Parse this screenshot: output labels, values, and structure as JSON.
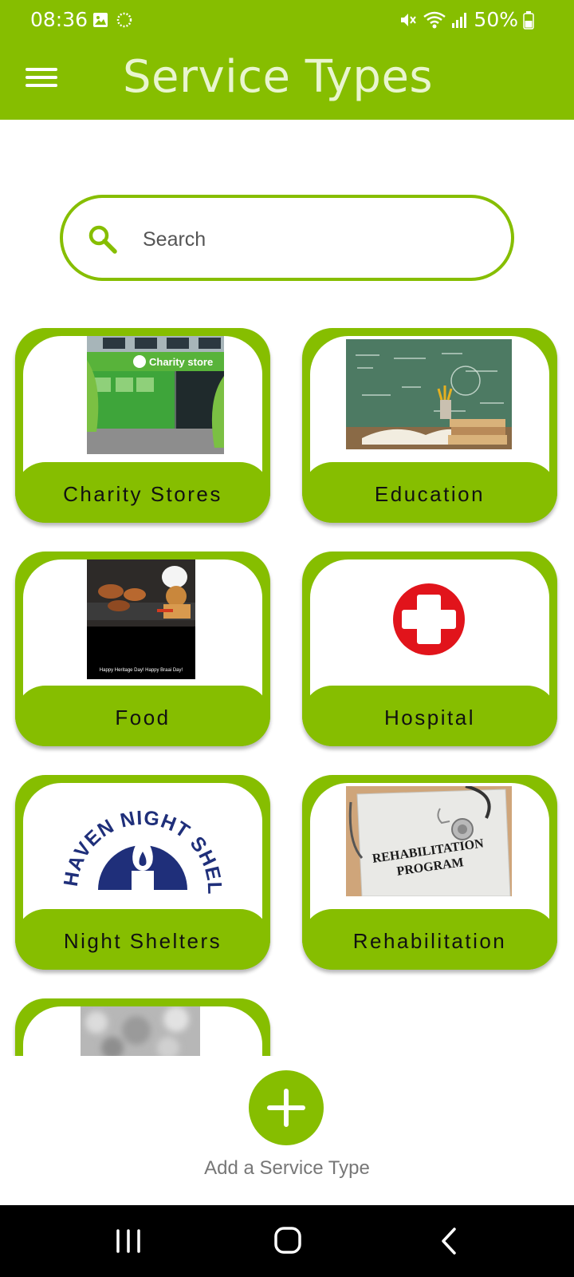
{
  "status_bar": {
    "time": "08:36",
    "battery": "50%",
    "icons": [
      "gallery-icon",
      "sync-icon",
      "mute-icon",
      "wifi-icon",
      "signal-icon",
      "battery-icon"
    ]
  },
  "app_bar": {
    "title": "Service Types",
    "menu_icon": "menu-icon"
  },
  "search": {
    "placeholder": "Search",
    "value": "",
    "icon": "search-icon"
  },
  "service_types": [
    {
      "label": "Charity Stores",
      "image": "charity-store-photo"
    },
    {
      "label": "Education",
      "image": "education-photo"
    },
    {
      "label": "Food",
      "image": "food-photo"
    },
    {
      "label": "Hospital",
      "image": "hospital-cross-icon"
    },
    {
      "label": "Night Shelters",
      "image": "haven-night-shelter-logo"
    },
    {
      "label": "Rehabilitation",
      "image": "rehabilitation-program-photo"
    },
    {
      "label": "",
      "image": "blurred-photo"
    }
  ],
  "image_text": {
    "charity_sign": "Charity store",
    "food_caption": "Happy Heritage Day! Happy Braai Day!",
    "shelter_logo": "THE HAVEN NIGHT SHELTER",
    "rehab_line1": "REHABILITATION",
    "rehab_line2": "PROGRAM"
  },
  "add_button": {
    "label": "Add a Service Type",
    "icon": "plus-icon"
  },
  "nav_bar": {
    "icons": [
      "recent-apps-icon",
      "home-icon",
      "back-icon"
    ]
  },
  "colors": {
    "accent": "#86be00",
    "title_text": "#e9f5cf",
    "nav_background": "#000000"
  }
}
